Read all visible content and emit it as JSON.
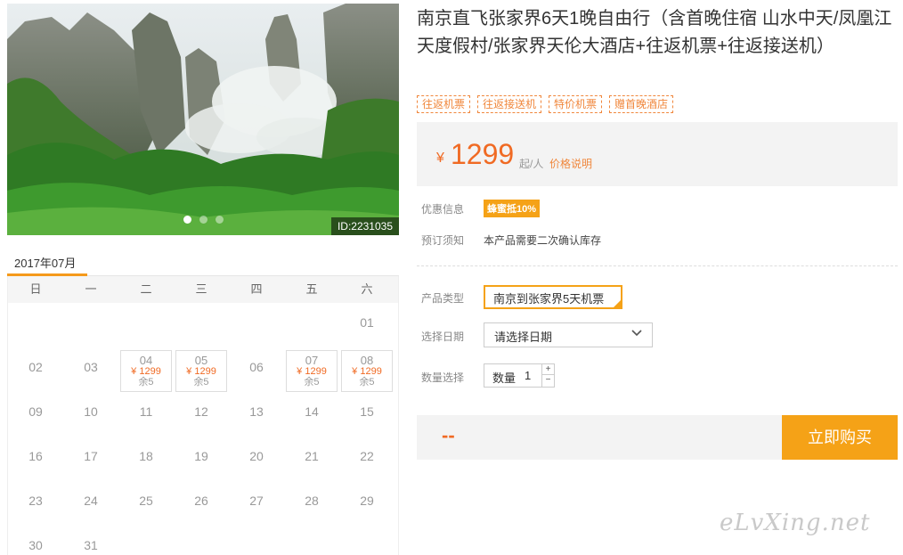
{
  "photo": {
    "id_label": "ID:2231035",
    "slides": 3,
    "active_slide": 0
  },
  "calendar": {
    "month_tab": "2017年07月",
    "weekdays": [
      "日",
      "一",
      "二",
      "三",
      "四",
      "五",
      "六"
    ],
    "weeks": [
      [
        {
          "d": ""
        },
        {
          "d": ""
        },
        {
          "d": ""
        },
        {
          "d": ""
        },
        {
          "d": ""
        },
        {
          "d": ""
        },
        {
          "d": "01"
        }
      ],
      [
        {
          "d": "02"
        },
        {
          "d": "03"
        },
        {
          "d": "04",
          "price": "¥ 1299",
          "stock": "余5"
        },
        {
          "d": "05",
          "price": "¥ 1299",
          "stock": "余5"
        },
        {
          "d": "06"
        },
        {
          "d": "07",
          "price": "¥ 1299",
          "stock": "余5"
        },
        {
          "d": "08",
          "price": "¥ 1299",
          "stock": "余5"
        }
      ],
      [
        {
          "d": "09"
        },
        {
          "d": "10"
        },
        {
          "d": "11"
        },
        {
          "d": "12"
        },
        {
          "d": "13"
        },
        {
          "d": "14"
        },
        {
          "d": "15"
        }
      ],
      [
        {
          "d": "16"
        },
        {
          "d": "17"
        },
        {
          "d": "18"
        },
        {
          "d": "19"
        },
        {
          "d": "20"
        },
        {
          "d": "21"
        },
        {
          "d": "22"
        }
      ],
      [
        {
          "d": "23"
        },
        {
          "d": "24"
        },
        {
          "d": "25"
        },
        {
          "d": "26"
        },
        {
          "d": "27"
        },
        {
          "d": "28"
        },
        {
          "d": "29"
        }
      ],
      [
        {
          "d": "30"
        },
        {
          "d": "31"
        },
        {
          "d": ""
        },
        {
          "d": ""
        },
        {
          "d": ""
        },
        {
          "d": ""
        },
        {
          "d": ""
        }
      ]
    ]
  },
  "product": {
    "title": "南京直飞张家界6天1晚自由行（含首晚住宿 山水中天/凤凰江天度假村/张家界天伦大酒店+往返机票+往返接送机）",
    "tags": [
      "往返机票",
      "往返接送机",
      "特价机票",
      "赠首晚酒店"
    ],
    "price_currency": "¥",
    "price": "1299",
    "price_unit": "起/人",
    "price_note": "价格说明"
  },
  "info": {
    "promo_label": "优惠信息",
    "promo_badge": "蜂蜜抵10%",
    "notice_label": "预订须知",
    "notice_text": "本产品需要二次确认库存"
  },
  "form": {
    "product_type_label": "产品类型",
    "product_type_value": "南京到张家界5天机票",
    "date_label": "选择日期",
    "date_placeholder": "请选择日期",
    "qty_section_label": "数量选择",
    "qty_label": "数量",
    "qty_value": "1",
    "plus": "+",
    "minus": "−"
  },
  "purchase": {
    "total": "--",
    "buy_label": "立即购买"
  },
  "watermark": "eLvXing.net",
  "colors": {
    "accent": "#f5a217",
    "price": "#f06a23"
  },
  "icons": {
    "date_dropdown": "chevron-down-icon"
  }
}
